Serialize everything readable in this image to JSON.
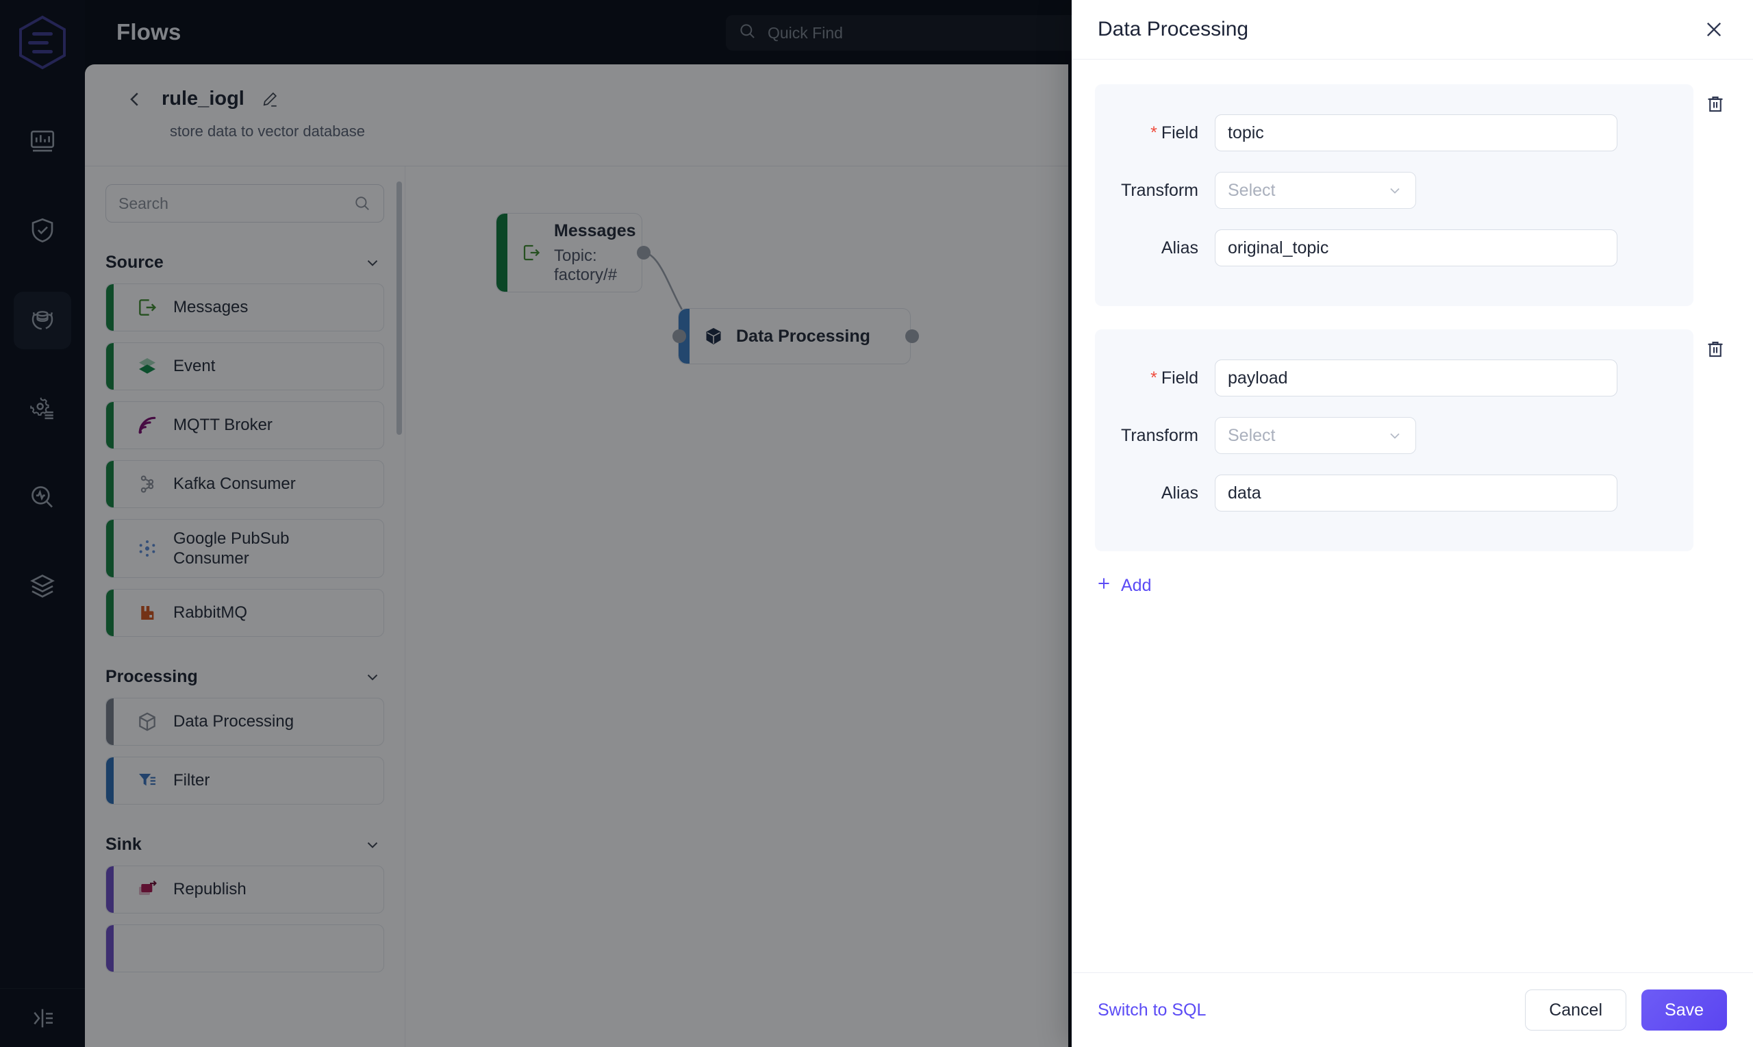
{
  "app": {
    "title": "Flows",
    "logo_icon": "hexagon-logo-icon"
  },
  "quick_find": {
    "placeholder": "Quick Find",
    "icon": "search-icon"
  },
  "rail": {
    "items": [
      {
        "name": "dashboard",
        "icon": "chart-bar-icon",
        "active": false
      },
      {
        "name": "access-control",
        "icon": "shield-check-icon",
        "active": false
      },
      {
        "name": "flows",
        "icon": "database-sync-icon",
        "active": true
      },
      {
        "name": "management",
        "icon": "gear-list-icon",
        "active": false
      },
      {
        "name": "diagnose",
        "icon": "pulse-search-icon",
        "active": false
      },
      {
        "name": "integration",
        "icon": "layers-icon",
        "active": false
      }
    ],
    "collapse_icon": "collapse-panel-icon"
  },
  "flow": {
    "back_icon": "chevron-left-icon",
    "name": "rule_iogl",
    "edit_icon": "pencil-icon",
    "description": "store data to vector database"
  },
  "palette": {
    "search_placeholder": "Search",
    "search_icon": "search-icon",
    "sections": [
      {
        "title": "Source",
        "chevron_icon": "chevron-down-icon",
        "items": [
          {
            "label": "Messages",
            "icon": "messages-icon",
            "bar": "#13833f"
          },
          {
            "label": "Event",
            "icon": "event-layers-icon",
            "bar": "#13833f"
          },
          {
            "label": "MQTT Broker",
            "icon": "mqtt-broker-icon",
            "bar": "#13833f"
          },
          {
            "label": "Kafka Consumer",
            "icon": "kafka-icon",
            "bar": "#13833f"
          },
          {
            "label": "Google PubSub Consumer",
            "icon": "google-pubsub-icon",
            "bar": "#13833f"
          },
          {
            "label": "RabbitMQ",
            "icon": "rabbitmq-icon",
            "bar": "#13833f"
          }
        ]
      },
      {
        "title": "Processing",
        "chevron_icon": "chevron-down-icon",
        "items": [
          {
            "label": "Data Processing",
            "icon": "cube-icon",
            "bar": "#767d89"
          },
          {
            "label": "Filter",
            "icon": "funnel-icon",
            "bar": "#2b6cb4"
          }
        ]
      },
      {
        "title": "Sink",
        "chevron_icon": "chevron-down-icon",
        "items": [
          {
            "label": "Republish",
            "icon": "republish-icon",
            "bar": "#6b4cc4"
          }
        ]
      }
    ]
  },
  "canvas": {
    "nodes": [
      {
        "title": "Messages",
        "subtitle": "Topic: factory/#",
        "icon": "messages-icon",
        "bar": "#0d7a39"
      },
      {
        "title": "Data Processing",
        "subtitle": "",
        "icon": "cube-icon",
        "bar": "#3a7cc0"
      }
    ]
  },
  "drawer": {
    "title": "Data Processing",
    "close_icon": "close-icon",
    "delete_icon": "trash-icon",
    "select_chevron_icon": "chevron-down-icon",
    "add_icon": "plus-icon",
    "add_label": "Add",
    "labels": {
      "field": "Field",
      "transform": "Transform",
      "alias": "Alias",
      "required_mark": "*"
    },
    "cards": [
      {
        "field_value": "topic",
        "transform_placeholder": "Select",
        "alias_value": "original_topic"
      },
      {
        "field_value": "payload",
        "transform_placeholder": "Select",
        "alias_value": "data"
      }
    ],
    "footer": {
      "switch_sql": "Switch to SQL",
      "cancel": "Cancel",
      "save": "Save"
    }
  },
  "colors": {
    "accent": "#5b4bf5",
    "required": "#ef4b3c",
    "source_bar": "#13833f",
    "drawer_bg": "#ffffff",
    "card_bg": "#f6f8fc"
  }
}
